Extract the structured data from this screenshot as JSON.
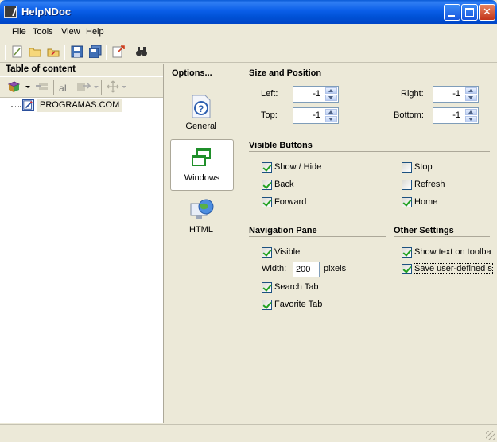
{
  "window": {
    "title": "HelpNDoc"
  },
  "menu": [
    "File",
    "Tools",
    "View",
    "Help"
  ],
  "toolbar": {
    "icons": [
      "new-project-icon",
      "open-folder-icon",
      "open-recent-icon",
      "save-icon",
      "save-all-icon",
      "compile-icon",
      "find-icon"
    ]
  },
  "left_panel": {
    "title": "Table of content",
    "tools": [
      "add-topic-icon",
      "dropdown-arrow-icon",
      "remove-topic-icon",
      "rename-icon",
      "move-icon",
      "arrows-icon"
    ],
    "tree": [
      {
        "label": "PROGRAMAS.COM",
        "icon": "topic-edit-icon"
      }
    ]
  },
  "options": {
    "title": "Options...",
    "items": [
      {
        "label": "General",
        "icon": "help-document-icon",
        "selected": false
      },
      {
        "label": "Windows",
        "icon": "windows-icon",
        "selected": true
      },
      {
        "label": "HTML",
        "icon": "html-globe-icon",
        "selected": false
      }
    ]
  },
  "settings": {
    "size_position": {
      "title": "Size and Position",
      "left_label": "Left:",
      "left_value": "-1",
      "top_label": "Top:",
      "top_value": "-1",
      "right_label": "Right:",
      "right_value": "-1",
      "bottom_label": "Bottom:",
      "bottom_value": "-1"
    },
    "visible_buttons": {
      "title": "Visible Buttons",
      "items": [
        {
          "label": "Show / Hide",
          "checked": true
        },
        {
          "label": "Back",
          "checked": true
        },
        {
          "label": "Forward",
          "checked": true
        },
        {
          "label": "Stop",
          "checked": false
        },
        {
          "label": "Refresh",
          "checked": false
        },
        {
          "label": "Home",
          "checked": true
        }
      ]
    },
    "navigation_pane": {
      "title": "Navigation Pane",
      "visible_label": "Visible",
      "visible_checked": true,
      "width_label": "Width:",
      "width_value": "200",
      "width_unit": "pixels",
      "search_tab_label": "Search Tab",
      "search_tab_checked": true,
      "favorite_tab_label": "Favorite Tab",
      "favorite_tab_checked": true
    },
    "other_settings": {
      "title": "Other Settings",
      "show_text_label": "Show text on toolba",
      "show_text_checked": true,
      "save_user_label": "Save user-defined s",
      "save_user_checked": true
    }
  }
}
